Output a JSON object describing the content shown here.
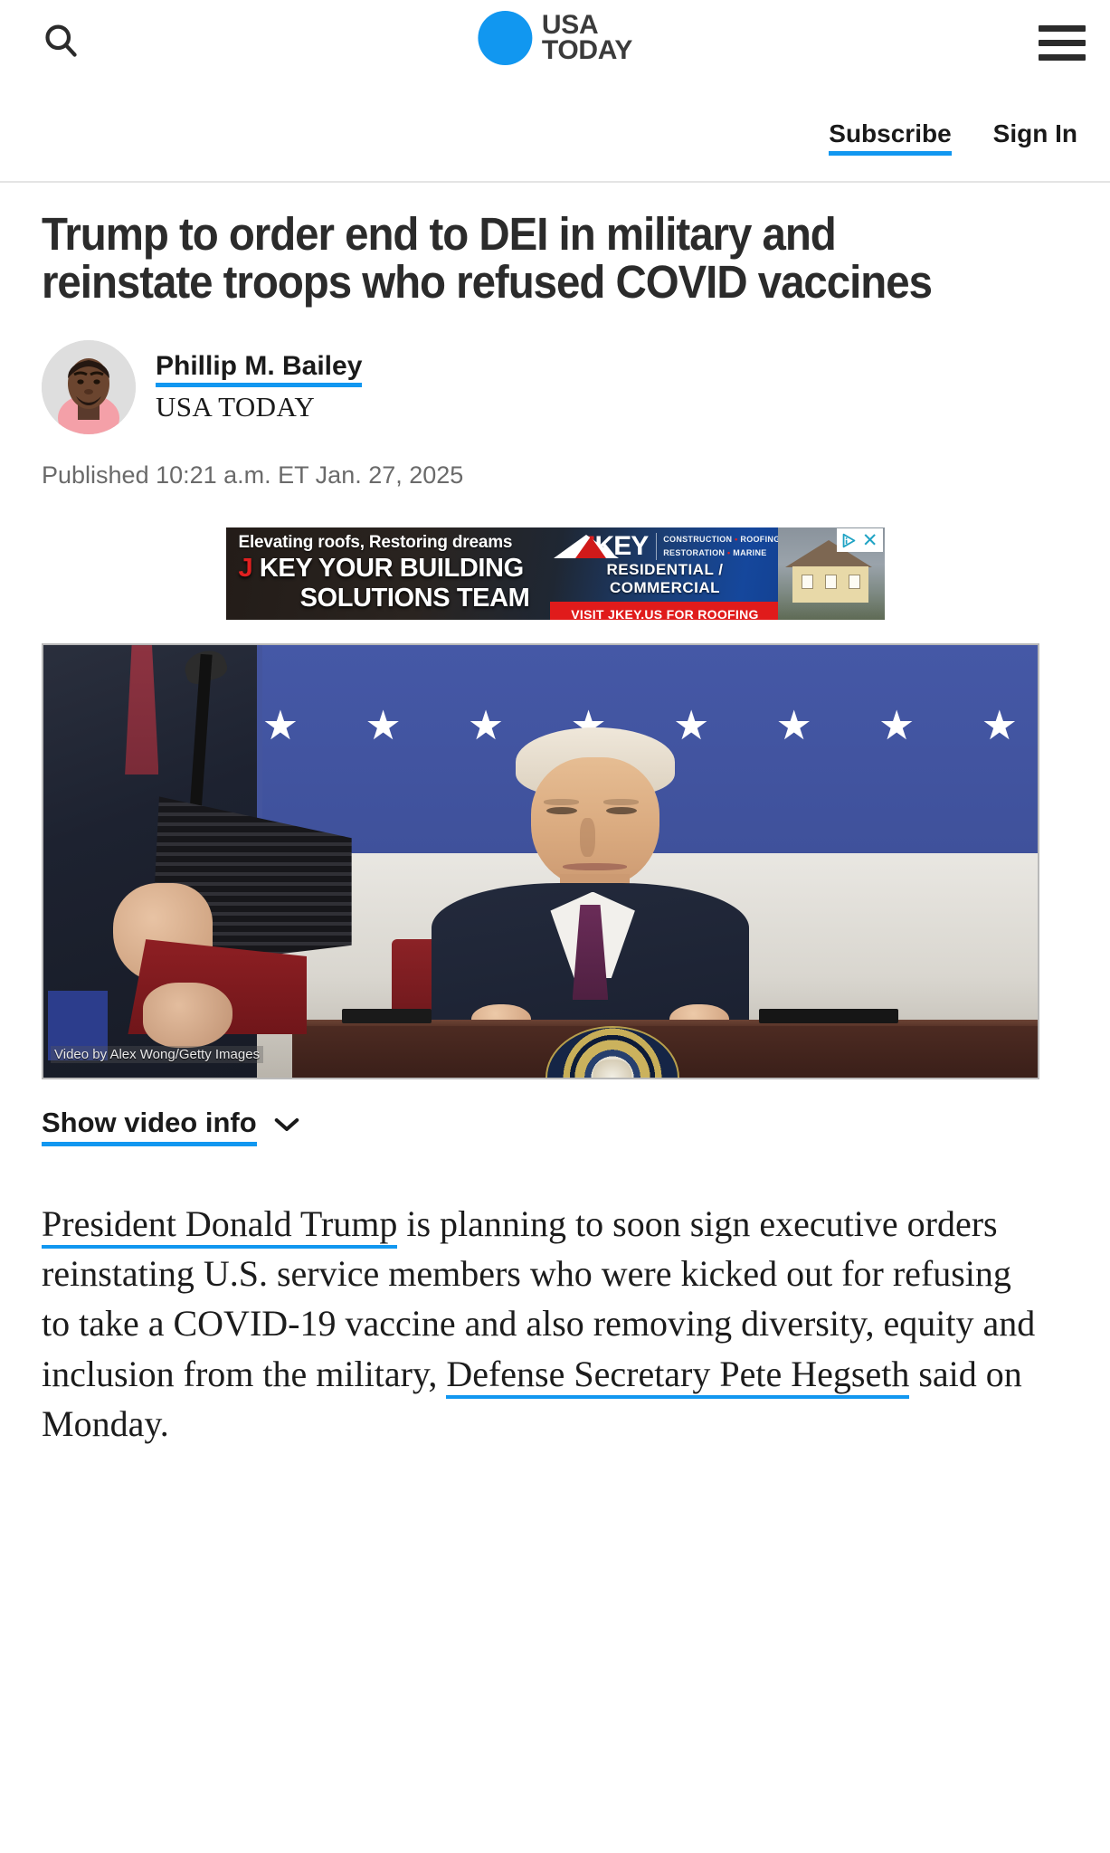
{
  "header": {
    "search_icon": "search-icon",
    "menu_icon": "hamburger-menu-icon",
    "logo": {
      "line1": "USA",
      "line2": "TODAY",
      "dot_color": "#1197F0",
      "text_color": "#3b3b3b"
    }
  },
  "utility": {
    "subscribe_label": "Subscribe",
    "signin_label": "Sign In",
    "accent_color": "#1197F0"
  },
  "article": {
    "headline": "Trump to order end to DEI in military and reinstate troops who refused COVID vaccines",
    "author_name": "Phillip M. Bailey",
    "author_org": "USA TODAY",
    "published": "Published 10:21 a.m. ET Jan. 27, 2025"
  },
  "ad": {
    "tagline": "Elevating roofs, Restoring dreams",
    "headline_j": "J",
    "headline_rest": " KEY YOUR BUILDING",
    "headline_line2": "SOLUTIONS TEAM",
    "logo_j": "J",
    "logo_key": "KEY",
    "sub_line1": "CONSTRUCTION",
    "sub_dot1": " • ",
    "sub_line1b": "ROOFING",
    "sub_line2": "RESTORATION",
    "sub_dot2": " • ",
    "sub_line2b": "MARINE",
    "residential": "RESIDENTIAL / COMMERCIAL",
    "cta": "VISIT JKEY.US FOR ROOFING",
    "adchoices_icon": "adchoices-icon",
    "close_icon": "✕"
  },
  "video": {
    "credit": "Video by Alex Wong/Getty Images",
    "star_glyph": "★",
    "stars_count": 8,
    "show_info_label": "Show video info",
    "chevron_icon": "chevron-down-icon"
  },
  "body": {
    "link1": "President Donald Trump",
    "seg1": " is planning to soon sign executive orders reinstating U.S. service members who were kicked out for refusing to take a COVID-19 vaccine and also removing diversity, equity and inclusion from the military, ",
    "link2": "Defense Secretary Pete Hegseth",
    "seg2": " said on Monday."
  }
}
